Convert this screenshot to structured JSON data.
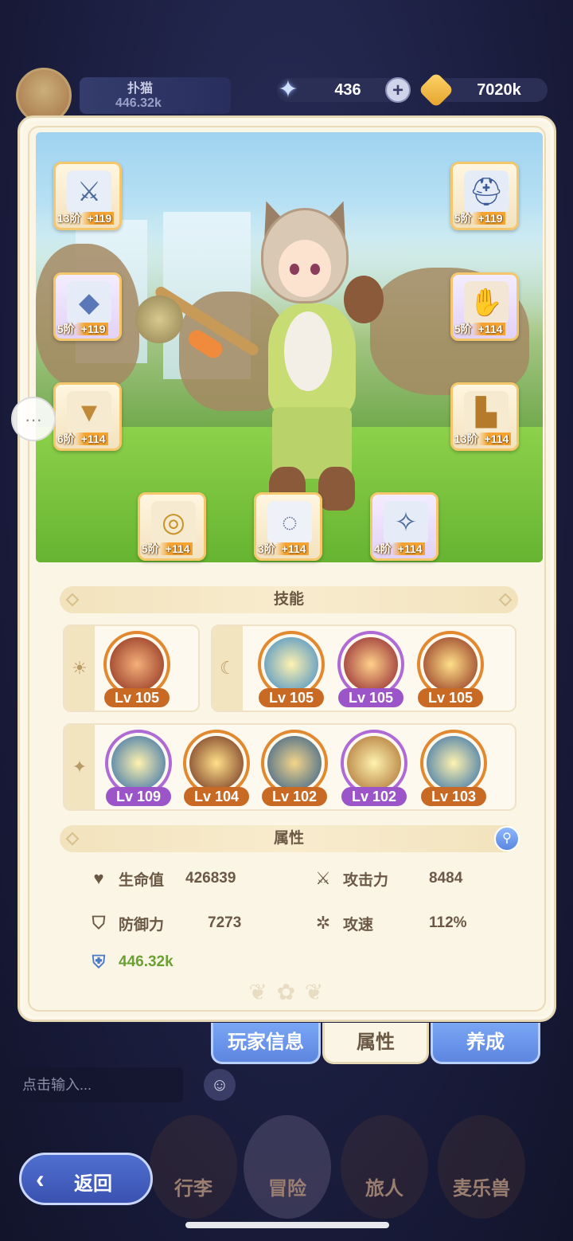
{
  "background": {
    "player_name": "扑猫",
    "player_power": "446.32k"
  },
  "currency": {
    "gems": "436",
    "gold": "7020k"
  },
  "equipment": [
    {
      "slot": "weapon",
      "icon": "axe-icon",
      "tier": "13阶",
      "bonus": "+119"
    },
    {
      "slot": "helmet",
      "icon": "helmet-icon",
      "tier": "5阶",
      "bonus": "+119"
    },
    {
      "slot": "armor",
      "icon": "armor-icon",
      "tier": "5阶",
      "bonus": "+119"
    },
    {
      "slot": "gloves",
      "icon": "gloves-icon",
      "tier": "5阶",
      "bonus": "+114"
    },
    {
      "slot": "pants",
      "icon": "pants-icon",
      "tier": "6阶",
      "bonus": "+114"
    },
    {
      "slot": "boots",
      "icon": "boots-icon",
      "tier": "13阶",
      "bonus": "+114"
    },
    {
      "slot": "ring",
      "icon": "ring-icon",
      "tier": "5阶",
      "bonus": "+114"
    },
    {
      "slot": "necklace",
      "icon": "necklace-icon",
      "tier": "3阶",
      "bonus": "+114"
    },
    {
      "slot": "charm",
      "icon": "charm-icon",
      "tier": "4阶",
      "bonus": "+114"
    }
  ],
  "skills_title": "技能",
  "skills": {
    "group1": [
      {
        "lv": "Lv 105",
        "rarity": "orange"
      }
    ],
    "group2": [
      {
        "lv": "Lv 105",
        "rarity": "orange"
      },
      {
        "lv": "Lv 105",
        "rarity": "purple"
      },
      {
        "lv": "Lv 105",
        "rarity": "orange"
      }
    ],
    "group3": [
      {
        "lv": "Lv 109",
        "rarity": "purple"
      },
      {
        "lv": "Lv 104",
        "rarity": "orange"
      },
      {
        "lv": "Lv 102",
        "rarity": "orange"
      },
      {
        "lv": "Lv 102",
        "rarity": "purple"
      },
      {
        "lv": "Lv 103",
        "rarity": "orange"
      }
    ]
  },
  "attributes_title": "属性",
  "attributes": {
    "hp_label": "生命值",
    "hp_value": "426839",
    "atk_label": "攻击力",
    "atk_value": "8484",
    "def_label": "防御力",
    "def_value": "7273",
    "spd_label": "攻速",
    "spd_value": "112%",
    "power_value": "446.32k"
  },
  "tabs": {
    "player_info": "玩家信息",
    "attributes": "属性",
    "cultivate": "养成"
  },
  "chat": {
    "placeholder": "点击输入..."
  },
  "nav": {
    "luggage": "行李",
    "adventure": "冒险",
    "traveler": "旅人",
    "pets": "麦乐兽"
  },
  "back_label": "返回"
}
